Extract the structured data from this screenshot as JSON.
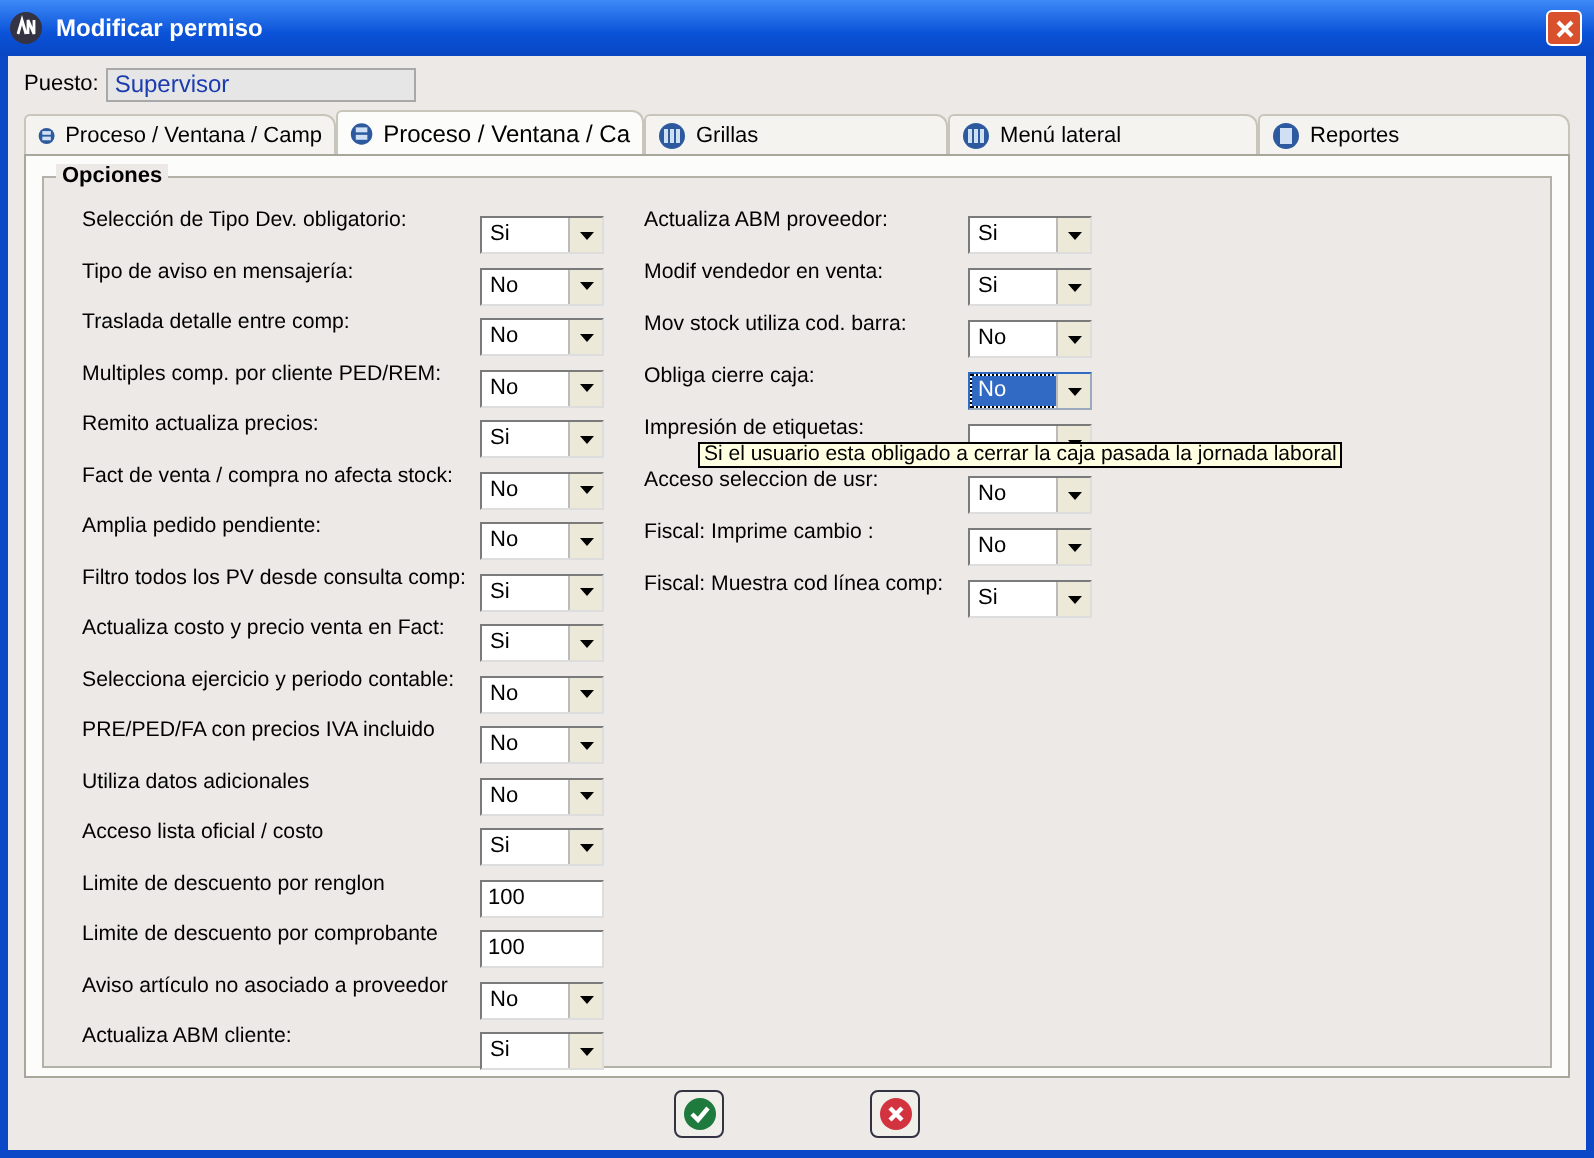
{
  "window": {
    "title": "Modificar permiso"
  },
  "puesto": {
    "label": "Puesto:",
    "value": "Supervisor"
  },
  "tabs": [
    {
      "label": "Proceso / Ventana / Camp",
      "selected": false
    },
    {
      "label": "Proceso / Ventana / Ca",
      "selected": true
    },
    {
      "label": "Grillas",
      "selected": false
    },
    {
      "label": "Menú lateral",
      "selected": false
    },
    {
      "label": "Reportes",
      "selected": false
    }
  ],
  "group": {
    "title": "Opciones"
  },
  "columns": [
    {
      "options": [
        {
          "label": "Selección de Tipo Dev. obligatorio:",
          "kind": "combo",
          "value": "Si",
          "focused": false
        },
        {
          "label": "Tipo de aviso en mensajería:",
          "kind": "combo",
          "value": "No",
          "focused": false
        },
        {
          "label": "Traslada detalle entre comp:",
          "kind": "combo",
          "value": "No",
          "focused": false
        },
        {
          "label": "Multiples comp. por cliente PED/REM:",
          "kind": "combo",
          "value": "No",
          "focused": false
        },
        {
          "label": "Remito actualiza precios:",
          "kind": "combo",
          "value": "Si",
          "focused": false
        },
        {
          "label": "Fact de venta / compra no afecta stock:",
          "kind": "combo",
          "value": "No",
          "focused": false
        },
        {
          "label": "Amplia pedido pendiente:",
          "kind": "combo",
          "value": "No",
          "focused": false
        },
        {
          "label": "Filtro todos los PV desde consulta comp:",
          "kind": "combo",
          "value": "Si",
          "focused": false
        },
        {
          "label": "Actualiza costo y precio venta en Fact:",
          "kind": "combo",
          "value": "Si",
          "focused": false
        },
        {
          "label": "Selecciona ejercicio y periodo contable:",
          "kind": "combo",
          "value": "No",
          "focused": false
        },
        {
          "label": "PRE/PED/FA con precios IVA incluido",
          "kind": "combo",
          "value": "No",
          "focused": false
        },
        {
          "label": "Utiliza datos adicionales",
          "kind": "combo",
          "value": "No",
          "focused": false
        },
        {
          "label": "Acceso lista oficial / costo",
          "kind": "combo",
          "value": "Si",
          "focused": false
        },
        {
          "label": "Limite de descuento por renglon",
          "kind": "text",
          "value": "100",
          "focused": false
        },
        {
          "label": "Limite de descuento por comprobante",
          "kind": "text",
          "value": "100",
          "focused": false
        },
        {
          "label": "Aviso artículo no asociado a proveedor",
          "kind": "combo",
          "value": "No",
          "focused": false
        },
        {
          "label": "Actualiza ABM cliente:",
          "kind": "combo",
          "value": "Si",
          "focused": false
        }
      ]
    },
    {
      "options": [
        {
          "label": "Actualiza ABM proveedor:",
          "kind": "combo",
          "value": "Si",
          "focused": false
        },
        {
          "label": "Modif vendedor en venta:",
          "kind": "combo",
          "value": "Si",
          "focused": false
        },
        {
          "label": "Mov stock utiliza cod. barra:",
          "kind": "combo",
          "value": "No",
          "focused": false
        },
        {
          "label": "Obliga cierre caja:",
          "kind": "combo",
          "value": "No",
          "focused": true
        },
        {
          "label": "Impresión de etiquetas:",
          "kind": "combo",
          "focused": false
        },
        {
          "label": "Acceso seleccion de usr:",
          "kind": "combo",
          "value": "No",
          "focused": false
        },
        {
          "label": "Fiscal: Imprime cambio :",
          "kind": "combo",
          "value": "No",
          "focused": false
        },
        {
          "label": "Fiscal: Muestra cod línea comp:",
          "kind": "combo",
          "value": "Si",
          "focused": false
        }
      ]
    }
  ],
  "tooltip": {
    "text": "Si el usuario esta obligado a cerrar la caja pasada la jornada laboral"
  }
}
